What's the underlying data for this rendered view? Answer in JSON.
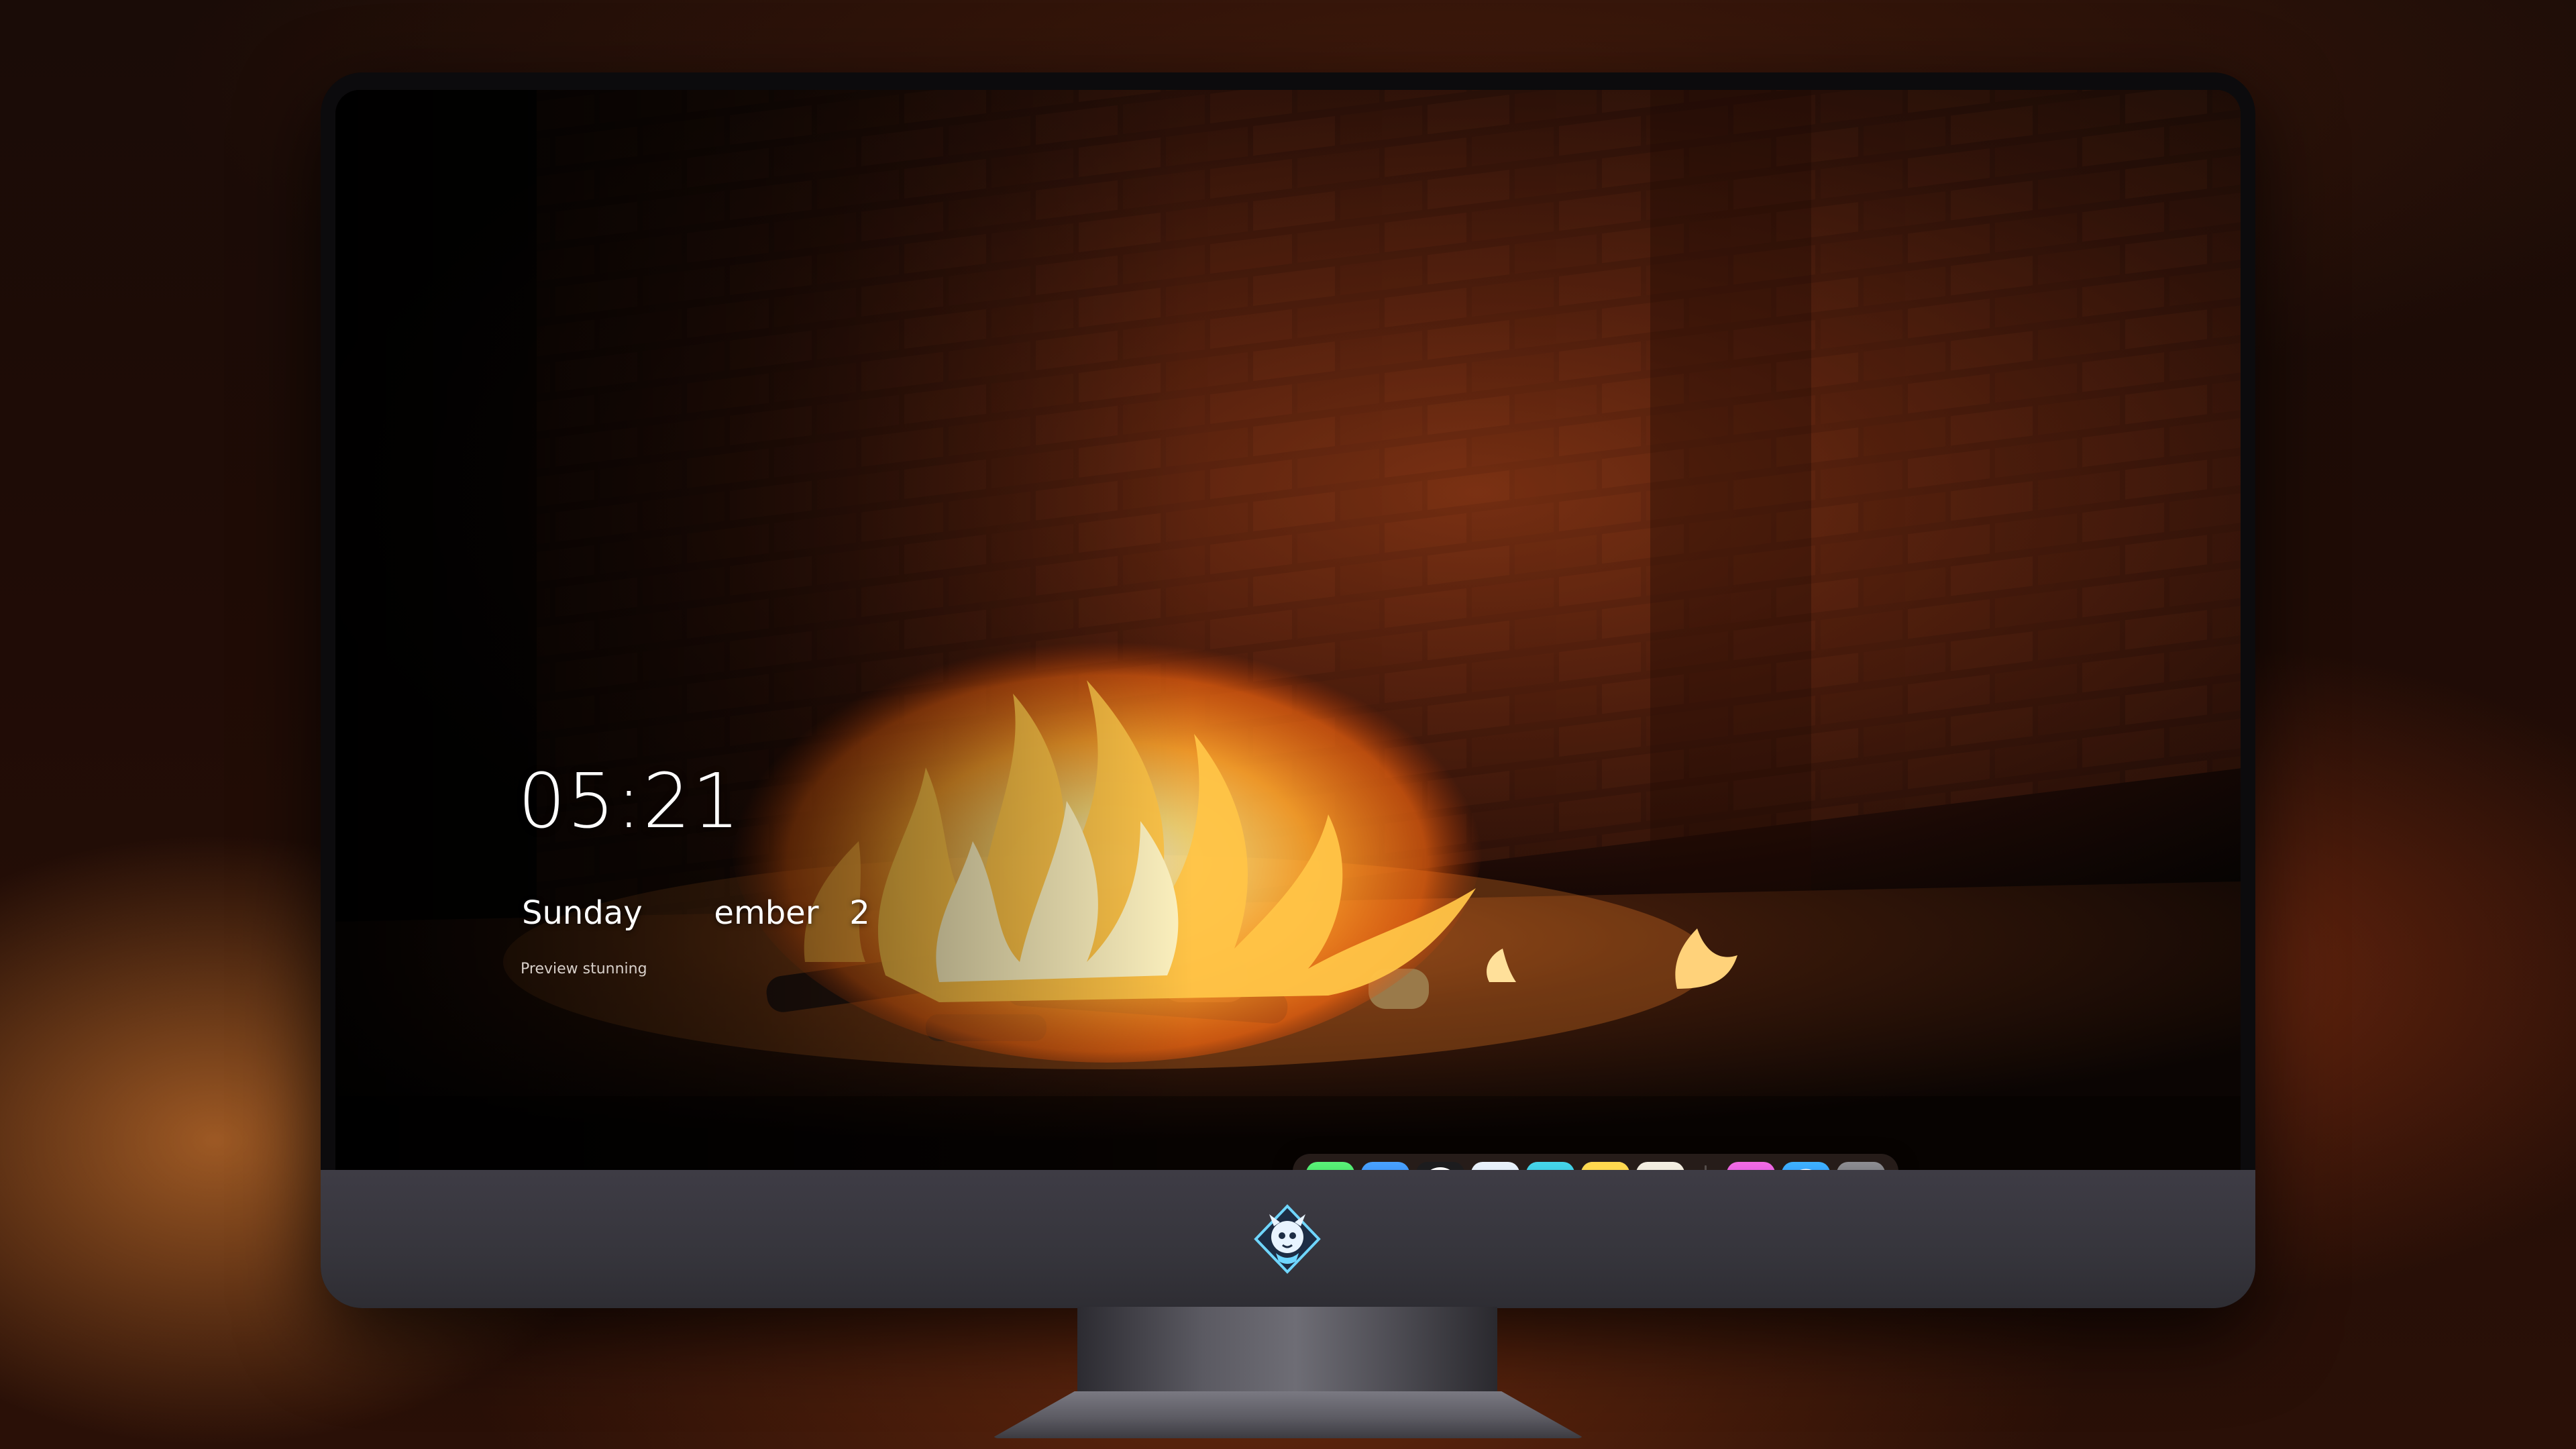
{
  "lock_screen": {
    "time": "05:21",
    "date": "Sunday       ember   2",
    "subtitle": "Preview stunning"
  },
  "dock": {
    "apps": [
      {
        "icon": "messages-icon",
        "color": "#2fd158"
      },
      {
        "icon": "weather-icon",
        "color": "#3a8ff7"
      },
      {
        "icon": "clock-icon",
        "color": "#ffffff"
      },
      {
        "icon": "preview-icon",
        "color": "#f5c84a"
      },
      {
        "icon": "claquette-icon",
        "color": "#2ec0d8"
      },
      {
        "icon": "notes-icon",
        "color": "#ffd84f"
      },
      {
        "icon": "photo-slideshow-icon",
        "color": "#e9e4d8"
      }
    ],
    "recent_apps": [
      {
        "icon": "itunes-icon",
        "color": "#e045d8"
      },
      {
        "icon": "app-store-icon",
        "color": "#2f8ef6"
      },
      {
        "icon": "screenshot-icon",
        "color": "#5a5a5f"
      }
    ]
  },
  "monitor": {
    "chin_logo": "dragon-mascot-logo",
    "chin_color": "#3b3a42",
    "bezel_color": "#0c0b0d"
  },
  "wallpaper": {
    "subject": "fireplace-flames-brick-wall",
    "ember_color": "#ff9a2e",
    "brick_color": "#5a2410"
  }
}
